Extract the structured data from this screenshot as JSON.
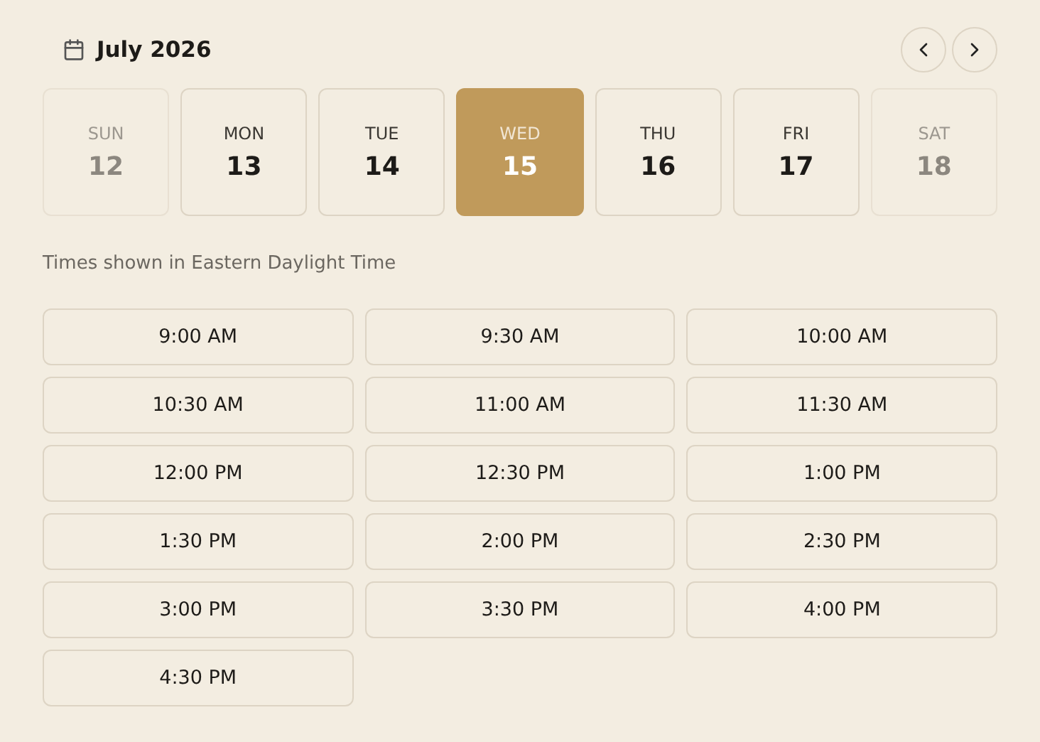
{
  "header": {
    "month": "July 2026"
  },
  "days": [
    {
      "weekday": "SUN",
      "date": "12",
      "selected": false,
      "disabled": true
    },
    {
      "weekday": "MON",
      "date": "13",
      "selected": false,
      "disabled": false
    },
    {
      "weekday": "TUE",
      "date": "14",
      "selected": false,
      "disabled": false
    },
    {
      "weekday": "WED",
      "date": "15",
      "selected": true,
      "disabled": false
    },
    {
      "weekday": "THU",
      "date": "16",
      "selected": false,
      "disabled": false
    },
    {
      "weekday": "FRI",
      "date": "17",
      "selected": false,
      "disabled": false
    },
    {
      "weekday": "SAT",
      "date": "18",
      "selected": false,
      "disabled": true
    }
  ],
  "timezone_note": "Times shown in Eastern Daylight Time",
  "slots": [
    "9:00 AM",
    "9:30 AM",
    "10:00 AM",
    "10:30 AM",
    "11:00 AM",
    "11:30 AM",
    "12:00 PM",
    "12:30 PM",
    "1:00 PM",
    "1:30 PM",
    "2:00 PM",
    "2:30 PM",
    "3:00 PM",
    "3:30 PM",
    "4:00 PM",
    "4:30 PM"
  ]
}
